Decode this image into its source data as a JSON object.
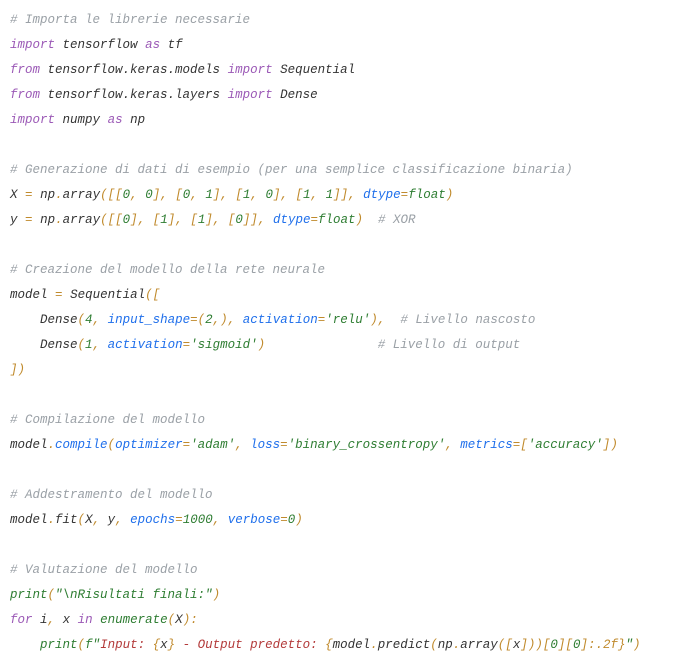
{
  "code": {
    "c_import_libs": "# Importa le librerie necessarie",
    "kw_import1": "import",
    "id_tensorflow": "tensorflow",
    "kw_as1": "as",
    "id_tf": "tf",
    "kw_from1": "from",
    "id_tf_keras_models": "tensorflow.keras.models",
    "kw_import2": "import",
    "id_sequential": "Sequential",
    "kw_from2": "from",
    "id_tf_keras_layers": "tensorflow.keras.layers",
    "kw_import3": "import",
    "id_dense": "Dense",
    "kw_import4": "import",
    "id_numpy": "numpy",
    "kw_as2": "as",
    "id_np": "np",
    "c_gen_data": "# Generazione di dati di esempio (per una semplice classificazione binaria)",
    "id_X": "X",
    "eq": "=",
    "id_np1": "np",
    "dot": ".",
    "id_array1": "array",
    "lp": "(",
    "rp": ")",
    "lb": "[",
    "rb": "]",
    "comma": ",",
    "n0": "0",
    "n1": "1",
    "id_dtype": "dtype",
    "id_float": "float",
    "id_y": "y",
    "id_np2": "np",
    "id_array2": "array",
    "c_xor": "# XOR",
    "c_create_model": "# Creazione del modello della rete neurale",
    "id_model": "model",
    "id_sequential2": "Sequential",
    "id_dense2": "Dense",
    "n4": "4",
    "id_input_shape": "input_shape",
    "n2": "2",
    "id_activation": "activation",
    "st_relu": "'relu'",
    "c_hidden": "# Livello nascosto",
    "id_dense3": "Dense",
    "st_sigmoid": "'sigmoid'",
    "c_output": "# Livello di output",
    "c_compile": "# Compilazione del modello",
    "id_compile": "compile",
    "id_optimizer": "optimizer",
    "st_adam": "'adam'",
    "id_loss": "loss",
    "st_bce": "'binary_crossentropy'",
    "id_metrics": "metrics",
    "st_accuracy": "'accuracy'",
    "c_train": "# Addestramento del modello",
    "id_fit": "fit",
    "id_epochs": "epochs",
    "n1000": "1000",
    "id_verbose": "verbose",
    "c_eval": "# Valutazione del modello",
    "id_print": "print",
    "st_results": "\"\\nRisultati finali:\"",
    "kw_for": "for",
    "id_i": "i",
    "id_x": "x",
    "kw_in": "in",
    "id_enumerate": "enumerate",
    "colon": ":",
    "fprefix": "f\"",
    "fs_input": "Input: ",
    "lbr": "{",
    "rbr": "}",
    "fs_dash_output": " - Output predetto: ",
    "id_predict": "predict",
    "id_np3": "np",
    "id_array3": "array",
    "fmt_spec": ":.2f",
    "endq": "\""
  }
}
